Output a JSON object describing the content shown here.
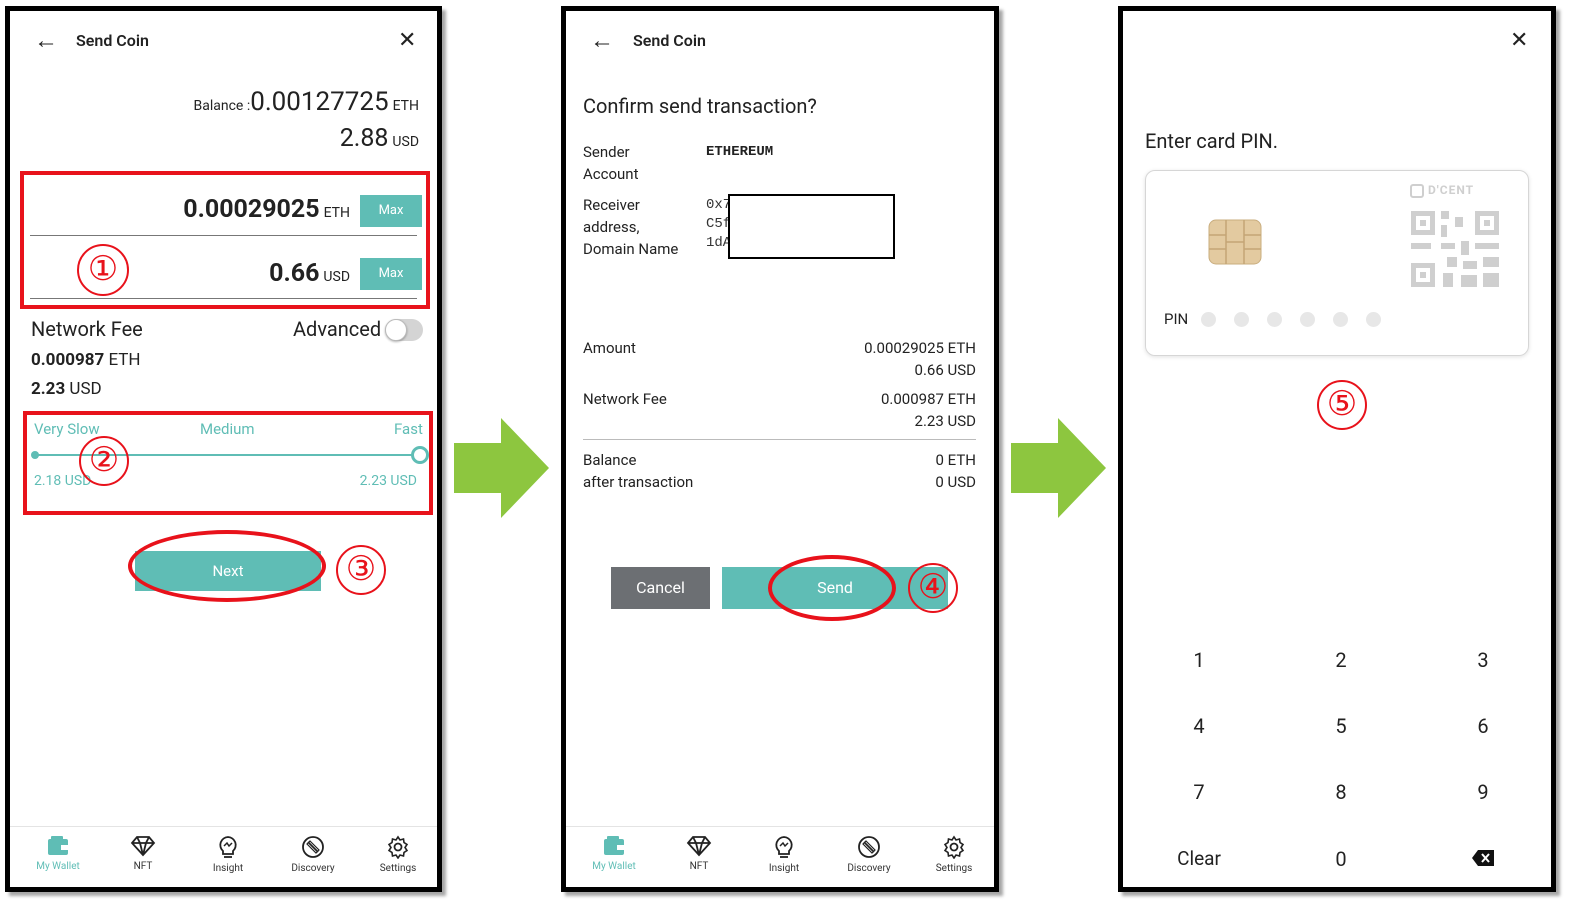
{
  "screen1": {
    "title": "Send Coin",
    "balance_label": "Balance :",
    "balance_eth": "0.00127725",
    "eth_unit": "ETH",
    "balance_usd": "2.88",
    "usd_unit": "USD",
    "amount_eth": "0.00029025",
    "amount_usd": "0.66",
    "max_label": "Max",
    "network_fee_label": "Network Fee",
    "advanced_label": "Advanced",
    "fee_eth": "0.000987",
    "fee_usd": "2.23",
    "slider": {
      "very_slow": "Very Slow",
      "medium": "Medium",
      "fast": "Fast",
      "low_usd": "2.18 USD",
      "high_usd": "2.23 USD",
      "level": 1.0
    },
    "next_label": "Next"
  },
  "screen2": {
    "title": "Send Coin",
    "confirm_heading": "Confirm send transaction?",
    "sender_label": "Sender\nAccount",
    "sender_value": "ETHEREUM",
    "receiver_label": "Receiver\naddress,\nDomain Name",
    "receiver_lines": [
      "0x7",
      "C5f",
      "1dA"
    ],
    "amount_label": "Amount",
    "amount_eth": "0.00029025 ETH",
    "amount_usd": "0.66 USD",
    "fee_label": "Network Fee",
    "fee_eth": "0.000987 ETH",
    "fee_usd": "2.23 USD",
    "balance_after_label": "Balance\nafter transaction",
    "balance_after_eth": "0 ETH",
    "balance_after_usd": "0 USD",
    "cancel_label": "Cancel",
    "send_label": "Send"
  },
  "screen3": {
    "heading": "Enter card PIN.",
    "brand": "D'CENT",
    "pin_label": "PIN",
    "keys": [
      "1",
      "2",
      "3",
      "4",
      "5",
      "6",
      "7",
      "8",
      "9",
      "Clear",
      "0"
    ]
  },
  "nav": {
    "items": [
      "My Wallet",
      "NFT",
      "Insight",
      "Discovery",
      "Settings"
    ]
  },
  "steps": [
    "①",
    "②",
    "③",
    "④",
    "⑤"
  ],
  "colors": {
    "teal": "#5fbdb5",
    "highlight_red": "#e8121b",
    "arrow_green": "#8dc63f",
    "cancel_gray": "#6c6f73"
  }
}
